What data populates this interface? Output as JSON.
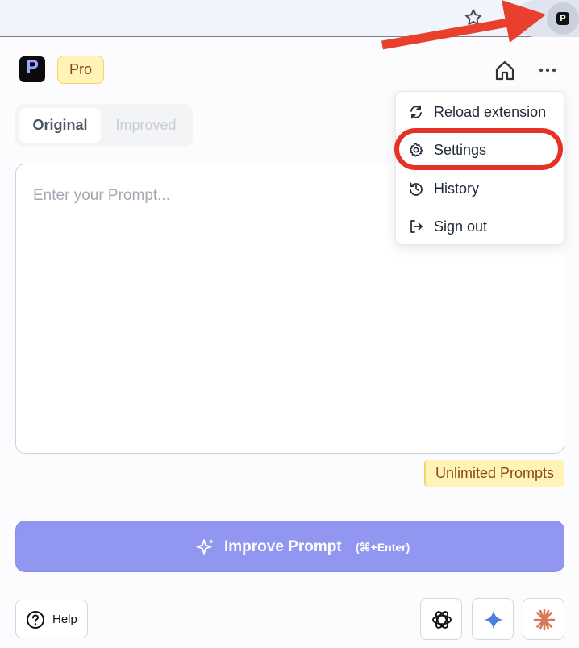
{
  "browser": {
    "extension_letter": "P"
  },
  "header": {
    "logo_letter": "P",
    "plan_badge": "Pro"
  },
  "tabs": [
    {
      "label": "Original",
      "active": true
    },
    {
      "label": "Improved",
      "active": false
    }
  ],
  "prompt": {
    "placeholder": "Enter your Prompt..."
  },
  "quota_badge": "Unlimited Prompts",
  "improve_button": {
    "label": "Improve Prompt",
    "shortcut": "(⌘+Enter)"
  },
  "help_button": {
    "label": "Help"
  },
  "menu": {
    "items": [
      {
        "label": "Reload extension",
        "icon": "reload-icon"
      },
      {
        "label": "Settings",
        "icon": "gear-icon",
        "highlighted": true
      },
      {
        "label": "History",
        "icon": "history-icon"
      },
      {
        "label": "Sign out",
        "icon": "sign-out-icon"
      }
    ]
  },
  "ai_launchers": [
    {
      "icon": "chatgpt-icon"
    },
    {
      "icon": "gemini-icon"
    },
    {
      "icon": "claude-icon"
    }
  ],
  "colors": {
    "accent": "#9196f0",
    "badge_bg": "#fff3b8",
    "badge_text": "#8a4a12",
    "annotation_red": "#e53224"
  }
}
